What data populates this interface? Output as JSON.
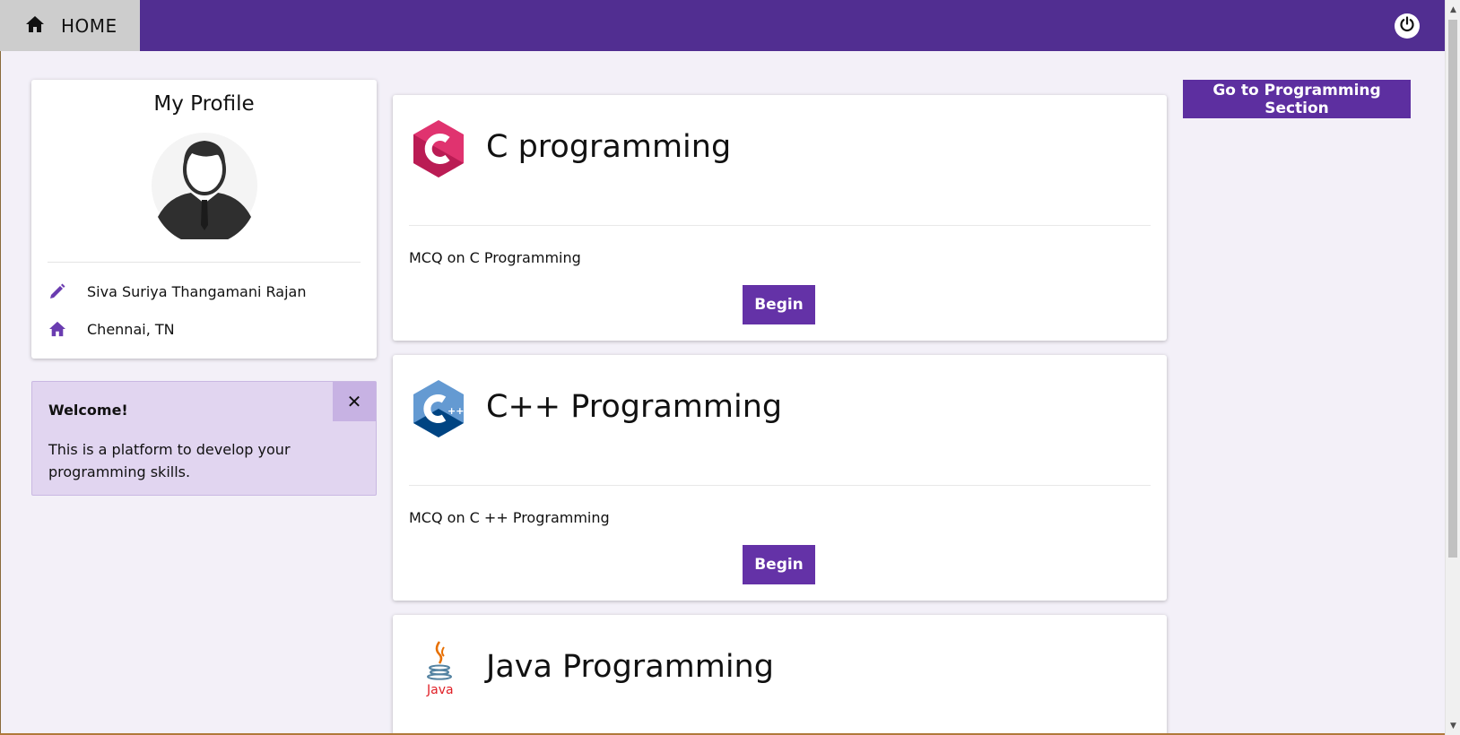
{
  "header": {
    "home_label": "HOME",
    "home_icon": "home-icon",
    "power_icon": "power-icon",
    "bar_color": "#512e91"
  },
  "profile": {
    "title": "My Profile",
    "name": "Siva Suriya Thangamani Rajan",
    "location": "Chennai, TN",
    "name_icon": "pencil-icon",
    "location_icon": "home-icon"
  },
  "alert": {
    "title": "Welcome!",
    "message": "This is a platform to develop your programming skills.",
    "close_icon": "close-icon"
  },
  "courses": [
    {
      "title": "C programming",
      "description": "MCQ on C Programming",
      "button": "Begin",
      "logo": "c-logo-icon"
    },
    {
      "title": "C++ Programming",
      "description": "MCQ on C ++ Programming",
      "button": "Begin",
      "logo": "cpp-logo-icon"
    },
    {
      "title": "Java Programming",
      "description": "",
      "button": "",
      "logo": "java-logo-icon",
      "logo_text": "Java"
    }
  ],
  "goto_button": "Go to Programming Section",
  "colors": {
    "accent": "#6432a7",
    "alert_bg": "#e1d5f0",
    "page_bg": "#f3f0f8"
  }
}
